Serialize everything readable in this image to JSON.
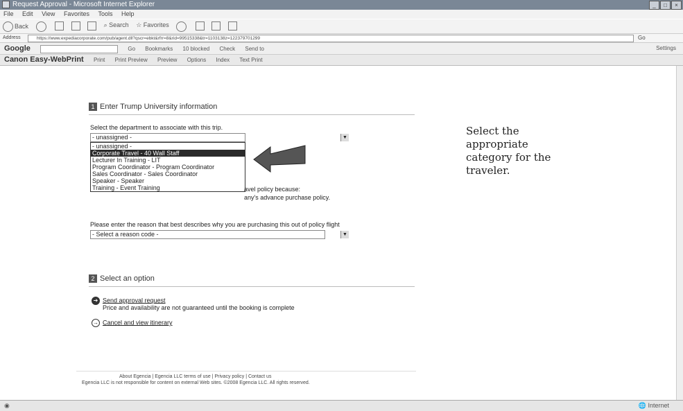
{
  "window": {
    "title": "Request Approval - Microsoft Internet Explorer"
  },
  "menu": [
    "File",
    "Edit",
    "View",
    "Favorites",
    "Tools",
    "Help"
  ],
  "toolbar": {
    "back": "Back",
    "search": "Search",
    "favorites": "Favorites"
  },
  "address": {
    "label": "Address",
    "url": "https://www.expediacorporate.com/pub/agent.dll?qscr=ebkt&rfrr=8&rid=99515338&tr=1103138z=122379701299",
    "go": "Go"
  },
  "google": {
    "label": "Google",
    "go": "Go",
    "bookmarks": "Bookmarks",
    "blocked": "10 blocked",
    "check": "Check",
    "sendto": "Send to",
    "settings": "Settings"
  },
  "canon": {
    "label": "Canon Easy-WebPrint",
    "items": [
      "Print",
      "Print Preview",
      "Preview",
      "Options",
      "Index",
      "Text Print"
    ]
  },
  "section1": {
    "num": "1",
    "title": "Enter Trump University information",
    "dept_label": "Select the department to associate with this trip.",
    "dept_value": "- unassigned -",
    "options": [
      "- unassigned -",
      "Corporate Travel - 40 Wall Staff",
      "Lecturer In Training - LIT",
      "Program Coordinator - Program Coordinator",
      "Sales Coordinator - Sales Coordinator",
      "Speaker - Speaker",
      "Training - Event Training"
    ],
    "policy_partial1": "avel policy because:",
    "policy_partial2": "any's advance purchase policy.",
    "reason_label": "Please enter the reason that best describes why you are purchasing this out of policy flight",
    "reason_value": "- Select a reason code -"
  },
  "section2": {
    "num": "2",
    "title": "Select an option",
    "send_link": "Send approval request",
    "send_desc": "Price and availability are not guaranteed until the booking is complete",
    "cancel_link": "Cancel and view itinerary"
  },
  "footer": {
    "links": "About Egencia | Egencia LLC terms of use | Privacy policy | Contact us",
    "legal": "Egencia LLC is not responsible for content on external Web sites. ©2008 Egencia LLC. All rights reserved."
  },
  "status": {
    "zone": "Internet"
  },
  "annotation": "Select the appropriate category for the traveler."
}
